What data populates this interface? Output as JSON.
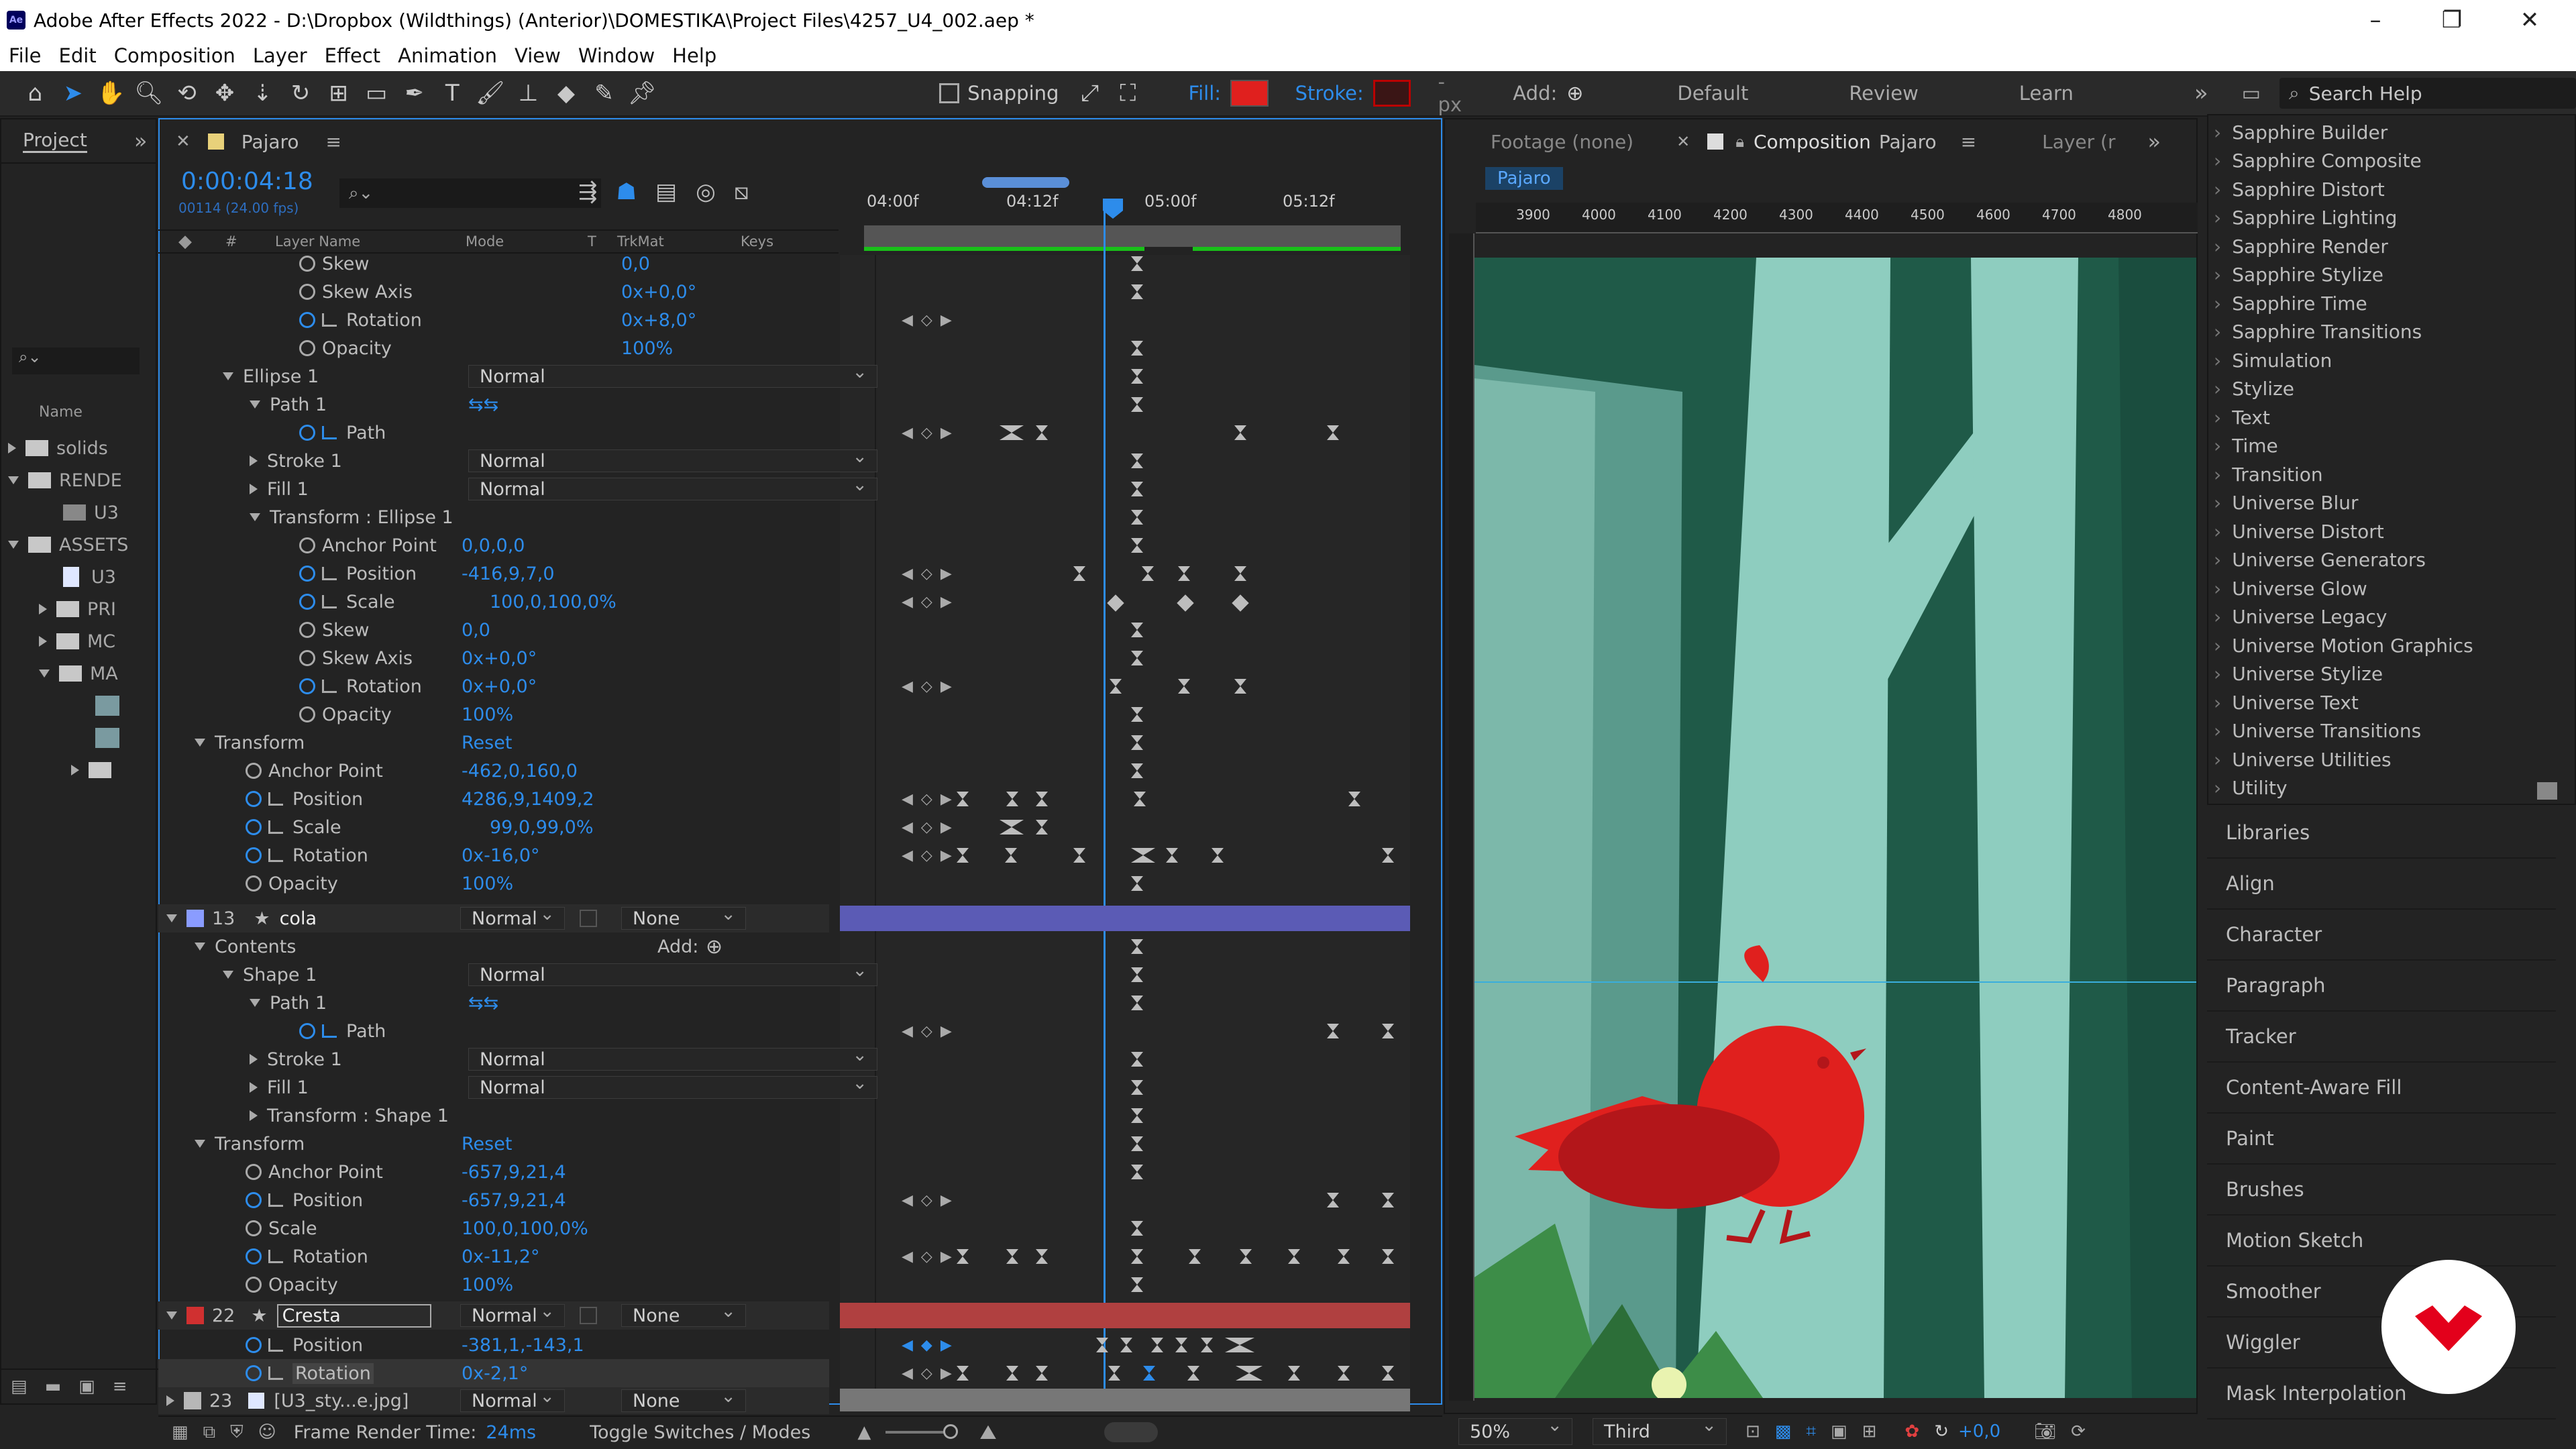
{
  "window": {
    "title": "Adobe After Effects 2022 - D:\\Dropbox (Wildthings) (Anterior)\\DOMESTIKA\\Project Files\\4257_U4_002.aep *",
    "logo": "Ae"
  },
  "menu": [
    "File",
    "Edit",
    "Composition",
    "Layer",
    "Effect",
    "Animation",
    "View",
    "Window",
    "Help"
  ],
  "toolbar": {
    "snapping": "Snapping",
    "fill": "Fill:",
    "stroke": "Stroke:",
    "stroke_px": "- px",
    "add": "Add:",
    "workspaces": [
      "Default",
      "Review",
      "Learn"
    ],
    "search_placeholder": "Search Help",
    "fill_color": "#e0201e"
  },
  "project": {
    "tab": "Project",
    "name_header": "Name",
    "items": [
      "solids",
      "RENDE",
      "U3",
      "ASSETS",
      "U3",
      "PRI",
      "MC",
      "MA"
    ]
  },
  "timeline": {
    "comp_tab": "Pajaro",
    "timecode": "0:00:04:18",
    "frame_info": "00114 (24.00 fps)",
    "headers": {
      "layer_name": "Layer Name",
      "mode": "Mode",
      "t": "T",
      "trkmat": "TrkMat",
      "keys": "Keys"
    },
    "ruler": [
      "04:00f",
      "04:12f",
      "05:00f",
      "05:12f"
    ],
    "frame_render_label": "Frame Render Time:",
    "frame_render_value": "24ms",
    "toggle_label": "Toggle Switches / Modes"
  },
  "layers": [
    {
      "label": "Skew",
      "value": "0,0"
    },
    {
      "label": "Skew Axis",
      "value": "0x+0,0°"
    },
    {
      "label": "Rotation",
      "value": "0x+8,0°"
    },
    {
      "label": "Opacity",
      "value": "100%"
    },
    {
      "label": "Ellipse 1",
      "mode": "Normal"
    },
    {
      "label": "Path 1"
    },
    {
      "label": "Path"
    },
    {
      "label": "Stroke 1",
      "mode": "Normal"
    },
    {
      "label": "Fill 1",
      "mode": "Normal"
    },
    {
      "label": "Transform : Ellipse 1"
    },
    {
      "label": "Anchor Point",
      "value": "0,0,0,0"
    },
    {
      "label": "Position",
      "value": "-416,9,7,0"
    },
    {
      "label": "Scale",
      "value": "100,0,100,0%"
    },
    {
      "label": "Skew",
      "value": "0,0"
    },
    {
      "label": "Skew Axis",
      "value": "0x+0,0°"
    },
    {
      "label": "Rotation",
      "value": "0x+0,0°"
    },
    {
      "label": "Opacity",
      "value": "100%"
    },
    {
      "label": "Transform",
      "value": "Reset"
    },
    {
      "label": "Anchor Point",
      "value": "-462,0,160,0"
    },
    {
      "label": "Position",
      "value": "4286,9,1409,2"
    },
    {
      "label": "Scale",
      "value": "99,0,99,0%"
    },
    {
      "label": "Rotation",
      "value": "0x-16,0°"
    },
    {
      "label": "Opacity",
      "value": "100%"
    },
    {
      "label": "cola",
      "num": "13",
      "mode": "Normal",
      "trk": "None"
    },
    {
      "label": "Contents",
      "value": "Add:"
    },
    {
      "label": "Shape 1",
      "mode": "Normal"
    },
    {
      "label": "Path 1"
    },
    {
      "label": "Path"
    },
    {
      "label": "Stroke 1",
      "mode": "Normal"
    },
    {
      "label": "Fill 1",
      "mode": "Normal"
    },
    {
      "label": "Transform : Shape 1"
    },
    {
      "label": "Transform",
      "value": "Reset"
    },
    {
      "label": "Anchor Point",
      "value": "-657,9,21,4"
    },
    {
      "label": "Position",
      "value": "-657,9,21,4"
    },
    {
      "label": "Scale",
      "value": "100,0,100,0%"
    },
    {
      "label": "Rotation",
      "value": "0x-11,2°"
    },
    {
      "label": "Opacity",
      "value": "100%"
    },
    {
      "label": "Cresta",
      "num": "22",
      "mode": "Normal",
      "trk": "None"
    },
    {
      "label": "Position",
      "value": "-381,1,-143,1"
    },
    {
      "label": "Rotation",
      "value": "0x-2,1°"
    },
    {
      "label": "[U3_sty...e.jpg]",
      "num": "23",
      "mode": "Normal",
      "trk": "None"
    }
  ],
  "viewer": {
    "footage_tab": "Footage (none)",
    "comp_label": "Composition",
    "comp_name": "Pajaro",
    "layer_tab": "Layer (r",
    "breadcrumb": "Pajaro",
    "ruler": [
      "3900",
      "4000",
      "4100",
      "4200",
      "4300",
      "4400",
      "4500",
      "4600",
      "4700",
      "4800"
    ],
    "zoom": "50%",
    "resolution": "Third",
    "exposure": "+0,0"
  },
  "effects": [
    "Sapphire Builder",
    "Sapphire Composite",
    "Sapphire Distort",
    "Sapphire Lighting",
    "Sapphire Render",
    "Sapphire Stylize",
    "Sapphire Time",
    "Sapphire Transitions",
    "Simulation",
    "Stylize",
    "Text",
    "Time",
    "Transition",
    "Universe Blur",
    "Universe Distort",
    "Universe Generators",
    "Universe Glow",
    "Universe Legacy",
    "Universe Motion Graphics",
    "Universe Stylize",
    "Universe Text",
    "Universe Transitions",
    "Universe Utilities",
    "Utility"
  ],
  "side_panels": [
    "Libraries",
    "Align",
    "Character",
    "Paragraph",
    "Tracker",
    "Content-Aware Fill",
    "Paint",
    "Brushes",
    "Motion Sketch",
    "Smoother",
    "Wiggler",
    "Mask Interpolation"
  ]
}
